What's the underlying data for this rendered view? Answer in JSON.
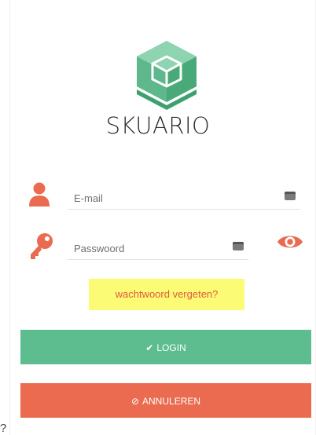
{
  "brand": {
    "name": "SKUARIO"
  },
  "login_form": {
    "email": {
      "placeholder": "E-mail",
      "value": ""
    },
    "password": {
      "placeholder": "Passwoord",
      "value": ""
    },
    "forgot_password_label": "wachtwoord vergeten?",
    "login_label": "LOGIN",
    "cancel_label": "ANNULEREN"
  },
  "icons": {
    "logo": "cube-logo-icon",
    "email": "user-icon",
    "password": "key-icon",
    "email_card": "id-card-icon",
    "password_card": "id-card-icon",
    "show_password": "eye-icon",
    "login": "check-icon",
    "cancel": "ban-icon"
  },
  "colors": {
    "logo_green": "#5dbd8f",
    "accent_orange": "#ea6b4f",
    "login_button": "#5dbd8f",
    "cancel_button": "#ea6b4f",
    "forgot_highlight": "#fbfb76",
    "forgot_text": "#e05a3a",
    "brand_text": "#2f2f2f"
  },
  "stray_text": "?"
}
